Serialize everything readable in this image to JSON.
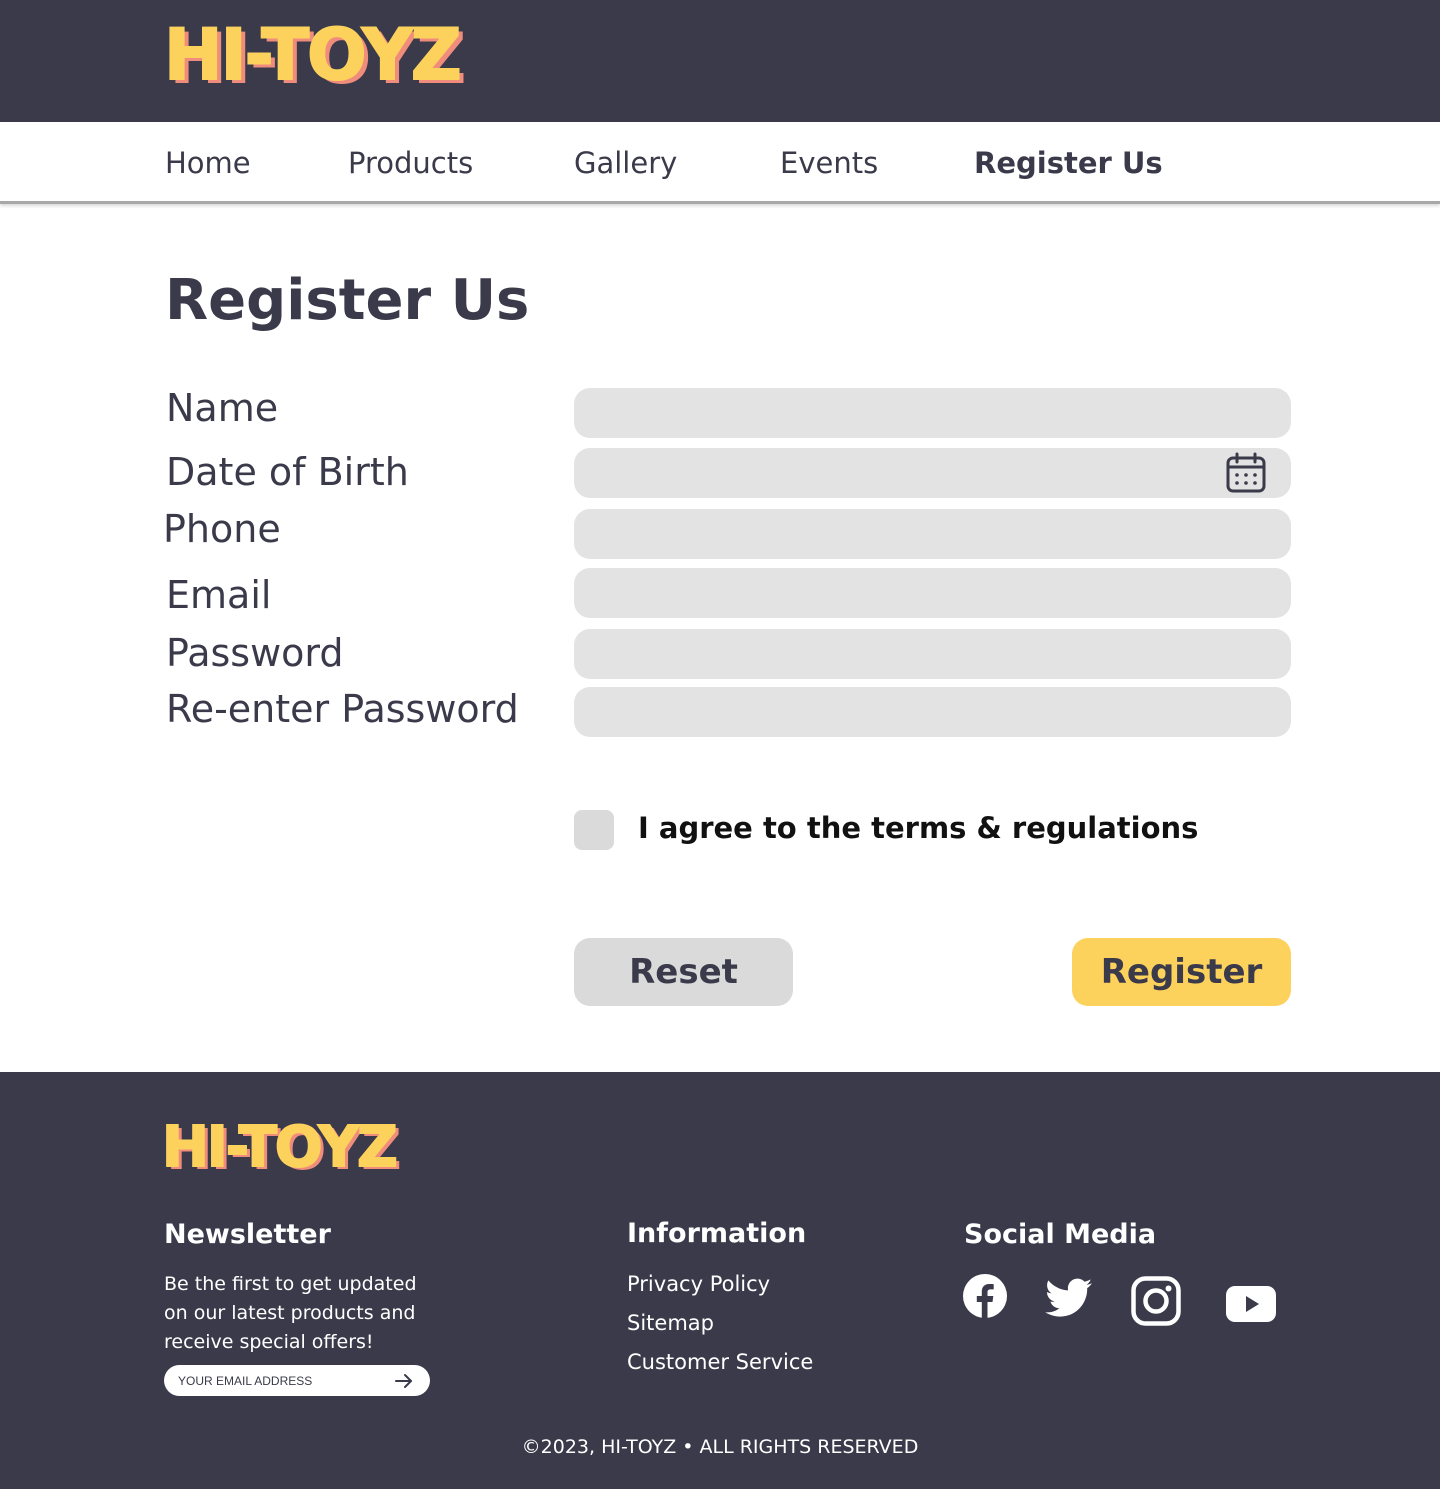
{
  "brand": {
    "logo_text": "HI-TOYZ",
    "primary_color": "#fdd25c",
    "shadow_color": "#f08c7c",
    "dark_color": "#3a3a4a"
  },
  "nav": {
    "items": [
      {
        "label": "Home"
      },
      {
        "label": "Products"
      },
      {
        "label": "Gallery"
      },
      {
        "label": "Events"
      },
      {
        "label": "Register Us"
      }
    ],
    "active": "Register Us"
  },
  "form": {
    "title": "Register Us",
    "fields": [
      {
        "label": "Name",
        "value": ""
      },
      {
        "label": "Date of Birth",
        "value": "",
        "icon": "calendar-icon"
      },
      {
        "label": "Phone",
        "value": ""
      },
      {
        "label": "Email",
        "value": ""
      },
      {
        "label": "Password",
        "value": ""
      },
      {
        "label": "Re-enter Password",
        "value": ""
      }
    ],
    "agree_label": "I agree to the terms & regulations",
    "agree_checked": false,
    "reset_label": "Reset",
    "register_label": "Register"
  },
  "footer": {
    "logo_text": "HI-TOYZ",
    "newsletter": {
      "heading": "Newsletter",
      "text": "Be the first to get updated on our latest products and receive special offers!",
      "placeholder": "YOUR EMAIL ADDRESS",
      "submit_icon": "arrow-right-icon"
    },
    "information": {
      "heading": "Information",
      "links": [
        "Privacy Policy",
        "Sitemap",
        "Customer Service"
      ]
    },
    "social": {
      "heading": "Social Media",
      "icons": [
        "facebook-icon",
        "twitter-icon",
        "instagram-icon",
        "youtube-icon"
      ]
    },
    "copyright": "©2023, HI-TOYZ • ALL RIGHTS RESERVED"
  }
}
